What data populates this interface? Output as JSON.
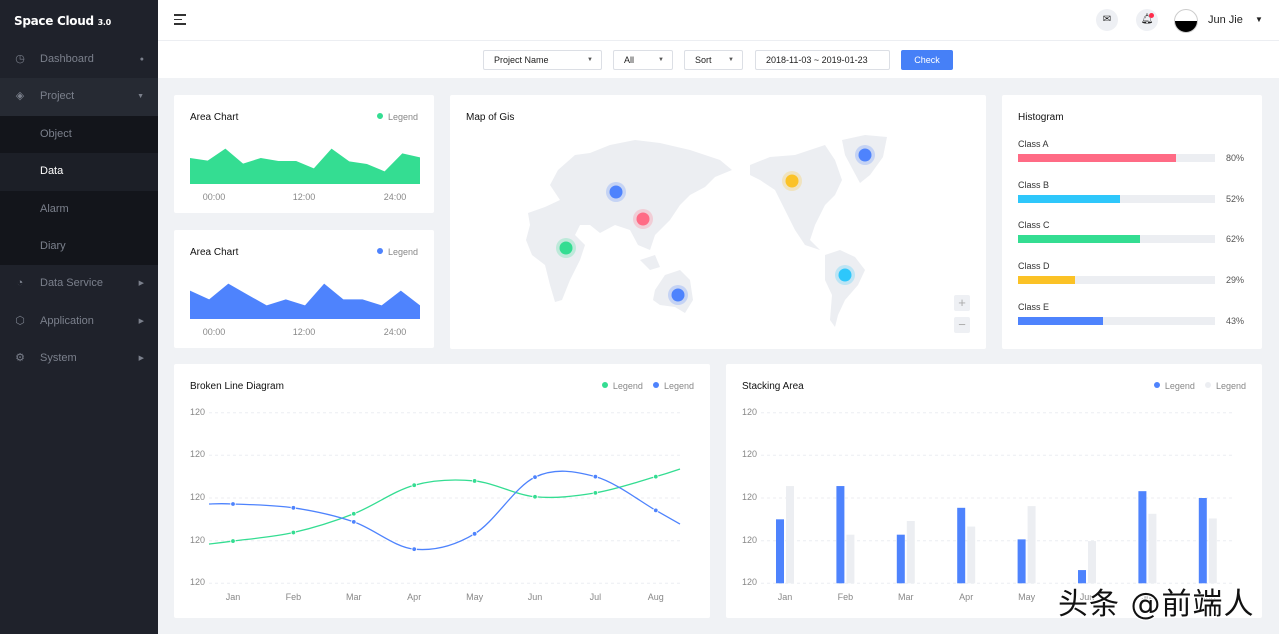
{
  "brand": {
    "name": "Space Cloud",
    "version": "3.0"
  },
  "sidebar": {
    "items": [
      {
        "label": "Dashboard",
        "icon": "dashboard-icon"
      },
      {
        "label": "Project",
        "icon": "layers-icon"
      },
      {
        "label": "Object"
      },
      {
        "label": "Data"
      },
      {
        "label": "Alarm"
      },
      {
        "label": "Diary"
      },
      {
        "label": "Data Service",
        "icon": "pie-icon"
      },
      {
        "label": "Application",
        "icon": "cube-icon"
      },
      {
        "label": "System",
        "icon": "gear-icon"
      }
    ],
    "active": "Data"
  },
  "header": {
    "user": "Jun Jie",
    "icons": [
      "menu-icon",
      "mail-icon",
      "bell-icon"
    ],
    "notification": true
  },
  "filters": {
    "project": "Project Name",
    "status": "All",
    "sort": "Sort",
    "date_range": "2018-11-03 ~ 2019-01-23",
    "check_label": "Check"
  },
  "colors": {
    "blue": "#4e83fd",
    "green": "#34dd92",
    "red": "#ff6b85",
    "cyan": "#2ec7fb",
    "yellow": "#fbc226",
    "gray": "#eceef2"
  },
  "area1": {
    "title": "Area Chart",
    "legend": "Legend",
    "color": "#34dd92",
    "x_ticks": [
      "00:00",
      "12:00",
      "24:00"
    ],
    "values": [
      78,
      70,
      106,
      61,
      78,
      69,
      69,
      47,
      106,
      68,
      60,
      38,
      92,
      80
    ]
  },
  "area2": {
    "title": "Area Chart",
    "legend": "Legend",
    "color": "#4e83fd",
    "x_ticks": [
      "00:00",
      "12:00",
      "24:00"
    ],
    "values": [
      85,
      59,
      106,
      73,
      41,
      59,
      41,
      106,
      59,
      59,
      41,
      85,
      41
    ]
  },
  "map": {
    "title": "Map of Gis",
    "zoom_in": "+",
    "zoom_out": "−",
    "markers": [
      {
        "region": "Central Asia",
        "color": "#4e83fd"
      },
      {
        "region": "China",
        "color": "#ff6b85"
      },
      {
        "region": "Africa",
        "color": "#34dd92"
      },
      {
        "region": "Australia",
        "color": "#4e83fd"
      },
      {
        "region": "North America",
        "color": "#fbc226"
      },
      {
        "region": "Greenland",
        "color": "#4e83fd"
      },
      {
        "region": "South America",
        "color": "#2ec7fb"
      }
    ]
  },
  "histogram": {
    "title": "Histogram",
    "items": [
      {
        "label": "Class A",
        "value": 80,
        "pct": "80%",
        "color": "#ff6b85"
      },
      {
        "label": "Class B",
        "value": 52,
        "pct": "52%",
        "color": "#2ec7fb"
      },
      {
        "label": "Class C",
        "value": 62,
        "pct": "62%",
        "color": "#34dd92"
      },
      {
        "label": "Class D",
        "value": 29,
        "pct": "29%",
        "color": "#fbc226"
      },
      {
        "label": "Class E",
        "value": 43,
        "pct": "43%",
        "color": "#4e83fd"
      }
    ]
  },
  "chart_data": [
    {
      "type": "line",
      "title": "Broken Line Diagram",
      "categories": [
        "Jan",
        "Feb",
        "Mar",
        "Apr",
        "May",
        "Jun",
        "Jul",
        "Aug"
      ],
      "y_ticks": [
        "120",
        "120",
        "120",
        "120",
        "120"
      ],
      "grid": true,
      "legend_position": "top-right",
      "series": [
        {
          "name": "Legend",
          "color": "#34dd92",
          "values": [
            0.99,
            1.19,
            1.63,
            2.3,
            2.4,
            2.03,
            2.12,
            2.5
          ]
        },
        {
          "name": "Legend",
          "color": "#4e83fd",
          "values": [
            1.86,
            1.77,
            1.44,
            0.8,
            1.16,
            2.49,
            2.5,
            1.71
          ]
        }
      ]
    },
    {
      "type": "bar",
      "title": "Stacking Area",
      "categories": [
        "Jan",
        "Feb",
        "Mar",
        "Apr",
        "May",
        "Jun",
        "Jul",
        "Aug"
      ],
      "y_ticks": [
        "120",
        "120",
        "120",
        "120",
        "120"
      ],
      "grid": true,
      "legend_position": "top-right",
      "series": [
        {
          "name": "Legend",
          "color": "#4e83fd",
          "values": [
            1.5,
            2.28,
            1.14,
            1.77,
            1.03,
            0.31,
            2.16,
            2.0
          ]
        },
        {
          "name": "Legend",
          "color": "#eceef2",
          "values": [
            2.28,
            1.14,
            1.46,
            1.33,
            1.81,
            0.99,
            1.63,
            1.52
          ]
        }
      ]
    }
  ],
  "watermark": "头条 @前端人"
}
